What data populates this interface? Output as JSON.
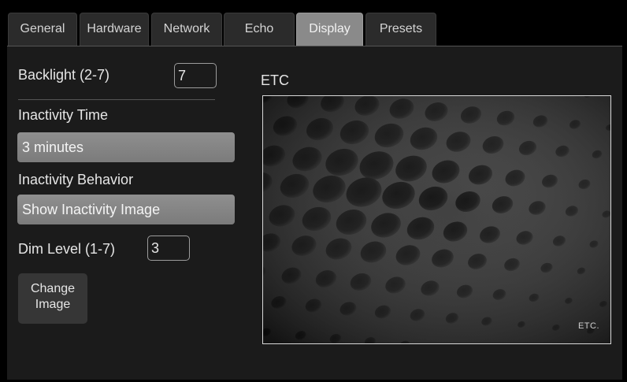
{
  "tabs": [
    {
      "label": "General",
      "active": false
    },
    {
      "label": "Hardware",
      "active": false
    },
    {
      "label": "Network",
      "active": false
    },
    {
      "label": "Echo",
      "active": false
    },
    {
      "label": "Display",
      "active": true
    },
    {
      "label": "Presets",
      "active": false
    }
  ],
  "display": {
    "backlight_label": "Backlight (2-7)",
    "backlight_value": "7",
    "inactivity_time_label": "Inactivity Time",
    "inactivity_time_value": "3 minutes",
    "inactivity_behavior_label": "Inactivity Behavior",
    "inactivity_behavior_value": "Show Inactivity Image",
    "dim_level_label": "Dim Level (1-7)",
    "dim_level_value": "3",
    "change_image_line1": "Change",
    "change_image_line2": "Image"
  },
  "preview": {
    "title": "ETC",
    "logo_text": "ETC."
  },
  "colors": {
    "active_tab": "#8a8a8a",
    "tab": "#2b2b2b",
    "panel": "#1b1b1b",
    "select_bar": "#8f8f8f"
  }
}
